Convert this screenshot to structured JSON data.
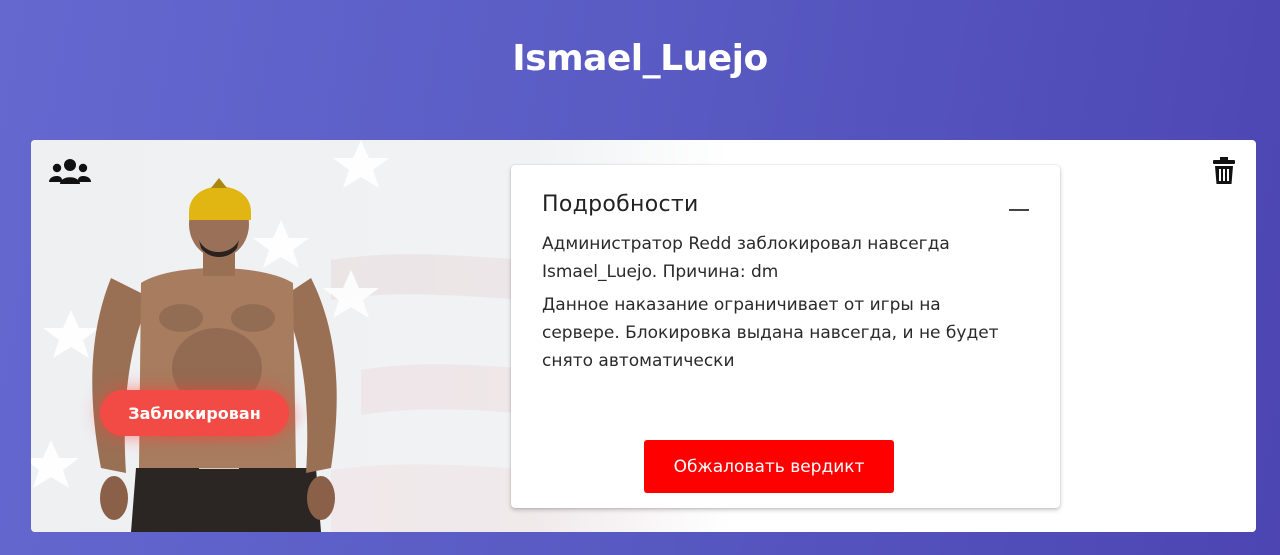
{
  "page": {
    "title": "Ismael_Luejo"
  },
  "card": {
    "status_badge": "Заблокирован",
    "icons": {
      "team": "users-icon",
      "delete": "trash-icon",
      "collapse": "minus-icon"
    },
    "details": {
      "heading": "Подробности",
      "summary": "Администратор Redd заблокировал навсегда Ismael_Luejo. Причина: dm",
      "description": "Данное наказание ограничивает от игры на сервере. Блокировка выдана навсегда, и не будет снято автоматически",
      "appeal_button": "Обжаловать вердикт"
    }
  },
  "colors": {
    "background_start": "#6468cf",
    "background_end": "#4c45b2",
    "badge": "#f24a45",
    "appeal_button": "#fe0000"
  }
}
